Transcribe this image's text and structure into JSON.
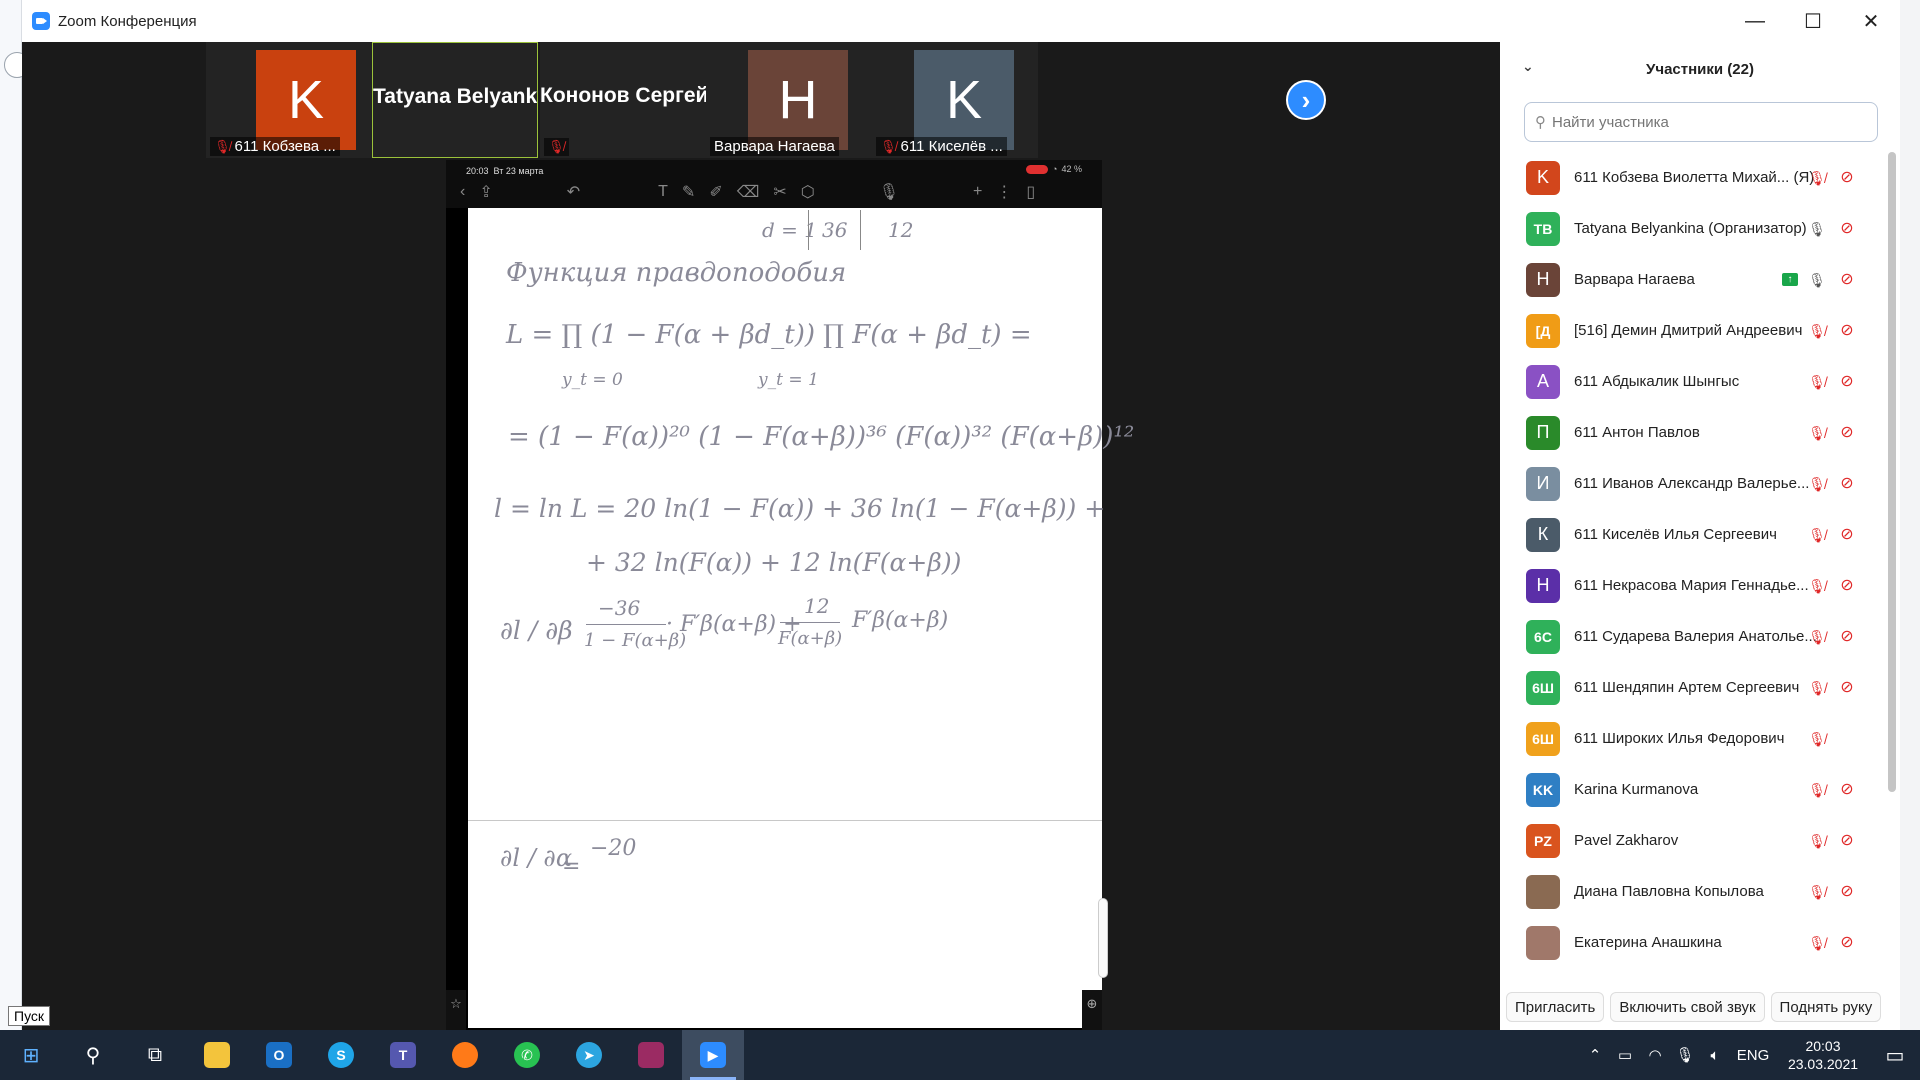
{
  "window": {
    "title": "Zoom Конференция",
    "minimize": "—",
    "maximize": "☐",
    "close": "✕"
  },
  "video_strip": {
    "tiles": [
      {
        "letter": "K",
        "name": "611 Кобзева ...",
        "color": "#c9410f",
        "muted": true
      },
      {
        "big_name": "Tatyana  Belyank...",
        "active": true
      },
      {
        "big_name": "Кононов Сергей",
        "muted": true
      },
      {
        "letter": "Н",
        "name": "Варвара Нагаева",
        "color": "#6a4438",
        "muted": false
      },
      {
        "letter": "K",
        "name": "611 Киселёв ...",
        "color": "#4b5b69",
        "muted": true
      }
    ],
    "next_icon": "chevron-right-icon"
  },
  "shared_screen": {
    "status_time": "20:03",
    "status_date": "Вт 23 марта",
    "battery": "42 %",
    "notes": {
      "table_row": "d = 1",
      "table_v1": "36",
      "table_v2": "12",
      "heading": "Функция правдоподобия",
      "line1": "L = ∏ (1 − F(α + βd_t)) ∏ F(α + βd_t) =",
      "line1_sub1": "y_t = 0",
      "line1_sub2": "y_t = 1",
      "line2": "= (1 − F(α))²⁰ (1 − F(α+β))³⁶ (F(α))³² (F(α+β))¹²",
      "line3": "l = ln L = 20 ln(1 − F(α)) + 36 ln(1 − F(α+β)) +",
      "line4": "+ 32 ln(F(α)) + 12 ln(F(α+β))",
      "deriv_beta_lhs": "∂l / ∂β",
      "deriv_beta_t1_num": "−36",
      "deriv_beta_t1_den": "1 − F(α+β)",
      "deriv_beta_t1_mul": "· F′β(α+β) +",
      "deriv_beta_t2_num": "12",
      "deriv_beta_t2_den": "F(α+β)",
      "deriv_beta_t2_mul": "F′β(α+β)",
      "deriv_alpha_lhs": "∂l / ∂α",
      "deriv_alpha_eq": "=",
      "deriv_alpha_val": "−20"
    }
  },
  "participants": {
    "header": "Участники (22)",
    "search_placeholder": "Найти участника",
    "list": [
      {
        "initials": "K",
        "name": "611 Кобзева Виолетта Михай... (Я)",
        "color": "#d2461c",
        "mic": "muted",
        "video": "off"
      },
      {
        "initials": "TB",
        "name": "Tatyana Belyankina (Организатор)",
        "color": "#2fb15a",
        "mic": "on",
        "video": "off"
      },
      {
        "initials": "Н",
        "name": "Варвара Нагаева",
        "color": "#6a4438",
        "mic": "on",
        "video": "off",
        "sharing": true
      },
      {
        "initials": "[Д",
        "name": "[516] Демин Дмитрий Андреевич",
        "color": "#f09c16",
        "mic": "muted",
        "video": "off"
      },
      {
        "initials": "А",
        "name": "611 Абдыкалик Шынгыс",
        "color": "#8a51c4",
        "mic": "muted",
        "video": "off"
      },
      {
        "initials": "П",
        "name": "611 Антон Павлов",
        "color": "#2a8a2a",
        "mic": "muted",
        "video": "off"
      },
      {
        "initials": "И",
        "name": "611 Иванов Александр Валерье...",
        "color": "#7a8ea0",
        "mic": "muted",
        "video": "off"
      },
      {
        "initials": "К",
        "name": "611 Киселёв Илья Сергеевич",
        "color": "#4b5b69",
        "mic": "muted",
        "video": "off"
      },
      {
        "initials": "Н",
        "name": "611 Некрасова Мария Геннадье...",
        "color": "#5b2fa8",
        "mic": "muted",
        "video": "off"
      },
      {
        "initials": "6С",
        "name": "611 Сударева Валерия Анатолье...",
        "color": "#2fb15a",
        "mic": "muted",
        "video": "off"
      },
      {
        "initials": "6Ш",
        "name": "611 Шендяпин Артем Сергеевич",
        "color": "#2fb15a",
        "mic": "muted",
        "video": "off"
      },
      {
        "initials": "6Ш",
        "name": "611 Широких Илья Федорович",
        "color": "#f0a11c",
        "mic": "muted",
        "video": "none"
      },
      {
        "initials": "KK",
        "name": "Karina Kurmanova",
        "color": "#2f7fc4",
        "mic": "muted",
        "video": "off"
      },
      {
        "initials": "PZ",
        "name": "Pavel Zakharov",
        "color": "#d9541e",
        "mic": "muted",
        "video": "off"
      },
      {
        "initials": "",
        "name": "Диана Павловна Копылова",
        "color": "#8a6a52",
        "mic": "muted",
        "video": "off",
        "photo": true
      },
      {
        "initials": "",
        "name": "Екатерина Анашкина",
        "color": "#a0786a",
        "mic": "muted",
        "video": "off",
        "photo": true
      }
    ],
    "buttons": {
      "invite": "Пригласить",
      "unmute": "Включить свой звук",
      "raise_hand": "Поднять руку"
    }
  },
  "start_tooltip": "Пуск",
  "taskbar": {
    "language": "ENG",
    "time": "20:03",
    "date": "23.03.2021"
  }
}
